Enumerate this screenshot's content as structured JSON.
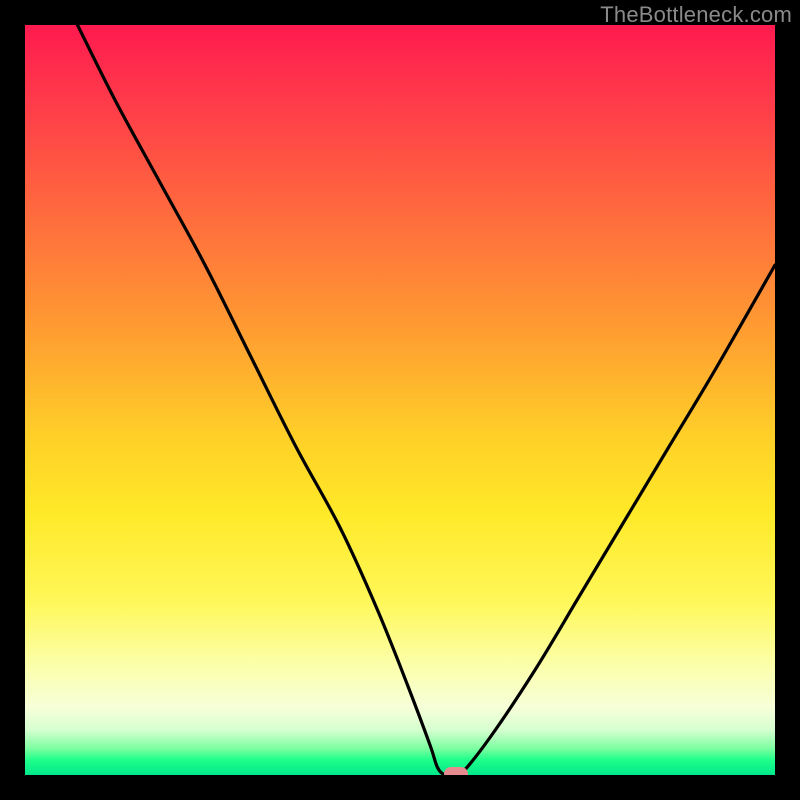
{
  "watermark": "TheBottleneck.com",
  "chart_data": {
    "type": "line",
    "title": "",
    "xlabel": "",
    "ylabel": "",
    "xlim": [
      0,
      100
    ],
    "ylim": [
      0,
      100
    ],
    "x": [
      7,
      12,
      18,
      24,
      30,
      36,
      42,
      47,
      51,
      54,
      55,
      56,
      57,
      58,
      62,
      68,
      74,
      80,
      86,
      92,
      100
    ],
    "values": [
      100,
      90,
      79,
      68,
      56,
      44,
      33,
      22,
      12,
      4,
      1,
      0,
      0,
      0,
      5,
      14,
      24,
      34,
      44,
      54,
      68
    ],
    "marker": {
      "x": 57.5,
      "y": 0
    },
    "colors": {
      "curve": "#000000",
      "marker": "#e58a8e",
      "gradient_top": "#ff1a4f",
      "gradient_bottom": "#00e88a"
    }
  }
}
